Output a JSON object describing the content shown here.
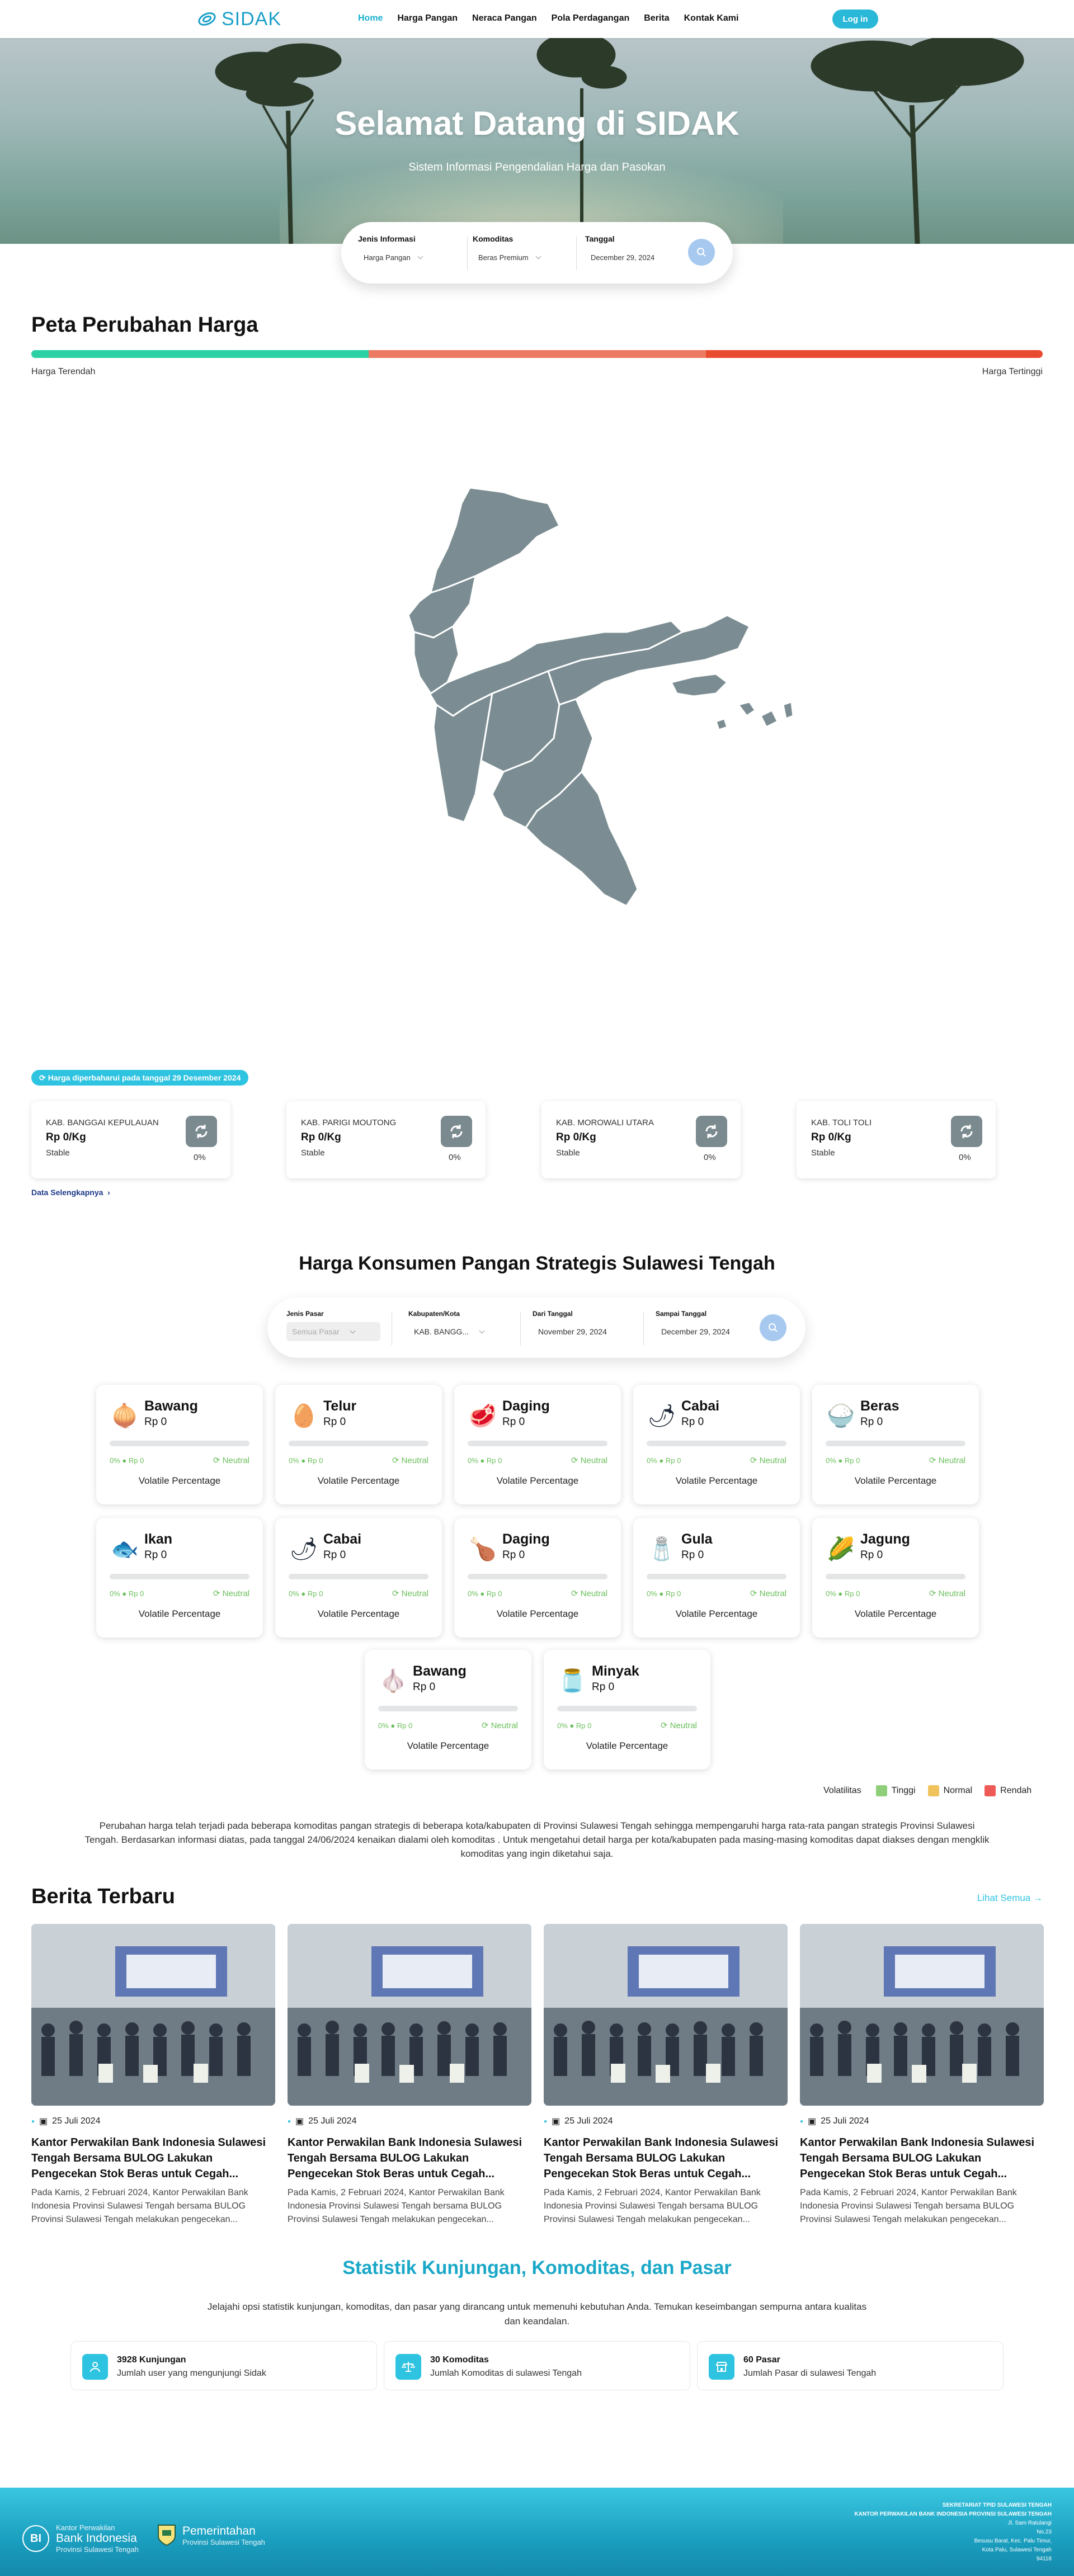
{
  "nav": {
    "logo": "SIDAK",
    "items": [
      "Home",
      "Harga Pangan",
      "Neraca Pangan",
      "Pola Perdagangan",
      "Berita",
      "Kontak Kami"
    ],
    "login": "Log in"
  },
  "hero": {
    "title": "Selamat Datang di SIDAK",
    "subtitle": "Sistem Informasi Pengendalian Harga dan Pasokan",
    "filter": {
      "jenis_label": "Jenis Informasi",
      "jenis_value": "Harga Pangan",
      "komoditas_label": "Komoditas",
      "komoditas_value": "Beras Premium",
      "tanggal_label": "Tanggal",
      "tanggal_value": "December 29, 2024"
    }
  },
  "map_section": {
    "title": "Peta Perubahan Harga",
    "low": "Harga Terendah",
    "high": "Harga Tertinggi",
    "bar_colors": [
      "#2bd1a4",
      "#ec7a63",
      "#e94b2f"
    ]
  },
  "update": {
    "badge": "Harga diperbaharui pada tanggal 29 Desember 2024",
    "cards": [
      {
        "region": "KAB. BANGGAI KEPULAUAN",
        "price": "Rp 0/Kg",
        "status": "Stable",
        "pct": "0%"
      },
      {
        "region": "KAB. PARIGI MOUTONG",
        "price": "Rp 0/Kg",
        "status": "Stable",
        "pct": "0%"
      },
      {
        "region": "KAB. MOROWALI UTARA",
        "price": "Rp 0/Kg",
        "status": "Stable",
        "pct": "0%"
      },
      {
        "region": "KAB. TOLI TOLI",
        "price": "Rp 0/Kg",
        "status": "Stable",
        "pct": "0%"
      }
    ],
    "more": "Data Selengkapnya"
  },
  "commodity": {
    "title": "Harga Konsumen Pangan Strategis Sulawesi Tengah",
    "filter": {
      "pasar_label": "Jenis Pasar",
      "pasar_value": "Semua Pasar",
      "kab_label": "Kabupaten/Kota",
      "kab_value": "KAB. BANGG...",
      "dari_label": "Dari Tanggal",
      "dari_value": "November 29, 2024",
      "sampai_label": "Sampai Tanggal",
      "sampai_value": "December 29, 2024"
    },
    "cards": [
      {
        "name": "Bawang",
        "price": "Rp 0",
        "icon": "🧅"
      },
      {
        "name": "Telur",
        "price": "Rp 0",
        "icon": "🥚"
      },
      {
        "name": "Daging",
        "price": "Rp 0",
        "icon": "🥩"
      },
      {
        "name": "Cabai",
        "price": "Rp 0",
        "icon": "🌶"
      },
      {
        "name": "Beras",
        "price": "Rp 0",
        "icon": "🍚"
      },
      {
        "name": "Ikan",
        "price": "Rp 0",
        "icon": "🐟"
      },
      {
        "name": "Cabai",
        "price": "Rp 0",
        "icon": "🌶"
      },
      {
        "name": "Daging",
        "price": "Rp 0",
        "icon": "🍗"
      },
      {
        "name": "Gula",
        "price": "Rp 0",
        "icon": "🧂"
      },
      {
        "name": "Jagung",
        "price": "Rp 0",
        "icon": "🌽"
      },
      {
        "name": "Bawang",
        "price": "Rp 0",
        "icon": "🧄"
      },
      {
        "name": "Minyak",
        "price": "Rp 0",
        "icon": "🫙"
      }
    ],
    "metric_pct": "0%",
    "metric_rp": "Rp 0",
    "neutral": "Neutral",
    "volatile_label": "Volatile Percentage",
    "legend": {
      "title": "Volatilitas",
      "tinggi": "Tinggi",
      "normal": "Normal",
      "rendah": "Rendah",
      "colors": [
        "#8fcf7a",
        "#f1c35d",
        "#ee5a55"
      ]
    },
    "paragraph": "Perubahan harga telah terjadi pada beberapa komoditas pangan strategis di beberapa kota/kabupaten di Provinsi Sulawesi Tengah sehingga mempengaruhi harga rata-rata pangan strategis Provinsi Sulawesi Tengah. Berdasarkan informasi diatas, pada tanggal 24/06/2024 kenaikan dialami oleh komoditas . Untuk mengetahui detail harga per kota/kabupaten pada masing-masing komoditas dapat diakses dengan mengklik komoditas yang ingin diketahui saja."
  },
  "news": {
    "title": "Berita Terbaru",
    "see_all": "Lihat Semua →",
    "items": [
      {
        "date": "25 Juli 2024",
        "title": "Kantor Perwakilan Bank Indonesia Sulawesi Tengah Bersama BULOG Lakukan Pengecekan Stok Beras untuk Cegah...",
        "desc": "Pada Kamis, 2 Februari 2024, Kantor Perwakilan Bank Indonesia Provinsi Sulawesi Tengah bersama BULOG Provinsi Sulawesi Tengah melakukan pengecekan..."
      },
      {
        "date": "25 Juli 2024",
        "title": "Kantor Perwakilan Bank Indonesia Sulawesi Tengah Bersama BULOG Lakukan Pengecekan Stok Beras untuk Cegah...",
        "desc": "Pada Kamis, 2 Februari 2024, Kantor Perwakilan Bank Indonesia Provinsi Sulawesi Tengah bersama BULOG Provinsi Sulawesi Tengah melakukan pengecekan..."
      },
      {
        "date": "25 Juli 2024",
        "title": "Kantor Perwakilan Bank Indonesia Sulawesi Tengah Bersama BULOG Lakukan Pengecekan Stok Beras untuk Cegah...",
        "desc": "Pada Kamis, 2 Februari 2024, Kantor Perwakilan Bank Indonesia Provinsi Sulawesi Tengah bersama BULOG Provinsi Sulawesi Tengah melakukan pengecekan..."
      },
      {
        "date": "25 Juli 2024",
        "title": "Kantor Perwakilan Bank Indonesia Sulawesi Tengah Bersama BULOG Lakukan Pengecekan Stok Beras untuk Cegah...",
        "desc": "Pada Kamis, 2 Februari 2024, Kantor Perwakilan Bank Indonesia Provinsi Sulawesi Tengah bersama BULOG Provinsi Sulawesi Tengah melakukan pengecekan..."
      }
    ]
  },
  "stats": {
    "title": "Statistik Kunjungan, Komoditas, dan Pasar",
    "desc": "Jelajahi opsi statistik kunjungan, komoditas, dan pasar yang dirancang untuk memenuhi kebutuhan Anda. Temukan keseimbangan sempurna antara kualitas dan keandalan.",
    "items": [
      {
        "value": "3928 Kunjungan",
        "desc": "Jumlah user yang mengunjungi Sidak"
      },
      {
        "value": "30 Komoditas",
        "desc": "Jumlah Komoditas di sulawesi Tengah"
      },
      {
        "value": "60 Pasar",
        "desc": "Jumlah Pasar di sulawesi Tengah"
      }
    ]
  },
  "footer": {
    "bi_small": "Kantor Perwakilan",
    "bi_name": "Bank Indonesia",
    "bi_sub": "Provinsi Sulawesi Tengah",
    "pem_name": "Pemerintahan",
    "pem_sub": "Provinsi Sulawesi Tengah",
    "right_1": "SEKRETARIAT TPID SULAWESI TENGAH",
    "right_2": "KANTOR PERWAKILAN BANK INDONESIA PROVINSI SULAWESI TENGAH",
    "right_3": "Jl. Sam Ratulangi",
    "right_4": "No.23",
    "right_5": "Besusu Barat, Kec. Palu Timur,",
    "right_6": "Kota Palu, Sulawesi Tengah",
    "right_7": "94118"
  }
}
